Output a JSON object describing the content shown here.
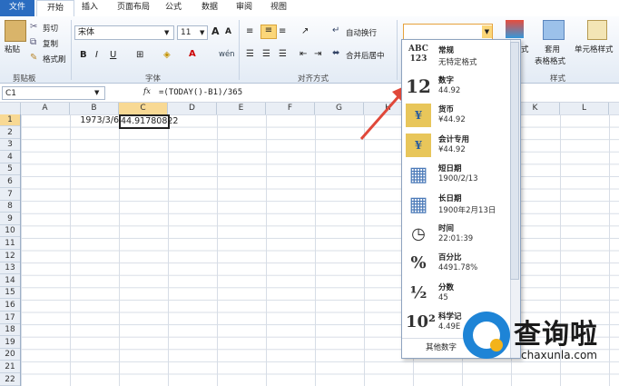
{
  "tabs": [
    "文件",
    "开始",
    "插入",
    "页面布局",
    "公式",
    "数据",
    "审阅",
    "视图"
  ],
  "clipboard": {
    "paste": "粘贴",
    "cut": "剪切",
    "copy": "复制",
    "format_painter": "格式刷",
    "label": "剪贴板"
  },
  "font": {
    "name": "宋体",
    "size": "11",
    "grow": "A",
    "shrink": "A",
    "bold": "B",
    "italic": "I",
    "underline": "U",
    "label": "字体",
    "phonetic": "wén"
  },
  "alignment": {
    "wrap": "自动换行",
    "merge": "合并后居中",
    "label": "对齐方式"
  },
  "styles": {
    "format_as_table": "套用",
    "format_as_table_2": "表格格式",
    "cell_styles": "单元格样式",
    "label": "样式",
    "cond_partial": "式"
  },
  "number_format_box": "",
  "formula_bar": {
    "name_box": "C1",
    "fx": "fx",
    "formula": "=(TODAY()-B1)/365"
  },
  "columns": [
    "A",
    "B",
    "C",
    "D",
    "E",
    "F",
    "G",
    "H",
    "I",
    "J",
    "K",
    "L"
  ],
  "rows": [
    "1",
    "2",
    "3",
    "4",
    "5",
    "6",
    "7",
    "8",
    "9",
    "10",
    "11",
    "12",
    "13",
    "14",
    "15",
    "16",
    "17",
    "18",
    "19",
    "20",
    "21",
    "22"
  ],
  "cells": {
    "B1": "1973/3/6",
    "C1": "44.91780822"
  },
  "format_menu": [
    {
      "icon": "ABC\n123",
      "name": "常规",
      "sample": "无特定格式"
    },
    {
      "icon": "12",
      "name": "数字",
      "sample": "44.92"
    },
    {
      "icon": "¥",
      "name": "货币",
      "sample": "¥44.92"
    },
    {
      "icon": "¥",
      "name": "会计专用",
      "sample": "¥44.92"
    },
    {
      "icon": "▦",
      "name": "短日期",
      "sample": "1900/2/13"
    },
    {
      "icon": "▦",
      "name": "长日期",
      "sample": "1900年2月13日"
    },
    {
      "icon": "◷",
      "name": "时间",
      "sample": "22:01:39"
    },
    {
      "icon": "%",
      "name": "百分比",
      "sample": "4491.78%"
    },
    {
      "icon": "½",
      "name": "分数",
      "sample": "45"
    },
    {
      "icon": "10²",
      "name": "科学记",
      "sample": "4.49E"
    }
  ],
  "format_menu_more": "其他数字",
  "watermark": {
    "cn": "查询啦",
    "url": "chaxunla.com"
  },
  "colors": {
    "file_tab": "#2a6cc0",
    "arrow": "#e0483a",
    "watermark_blue": "#1e84d6"
  }
}
